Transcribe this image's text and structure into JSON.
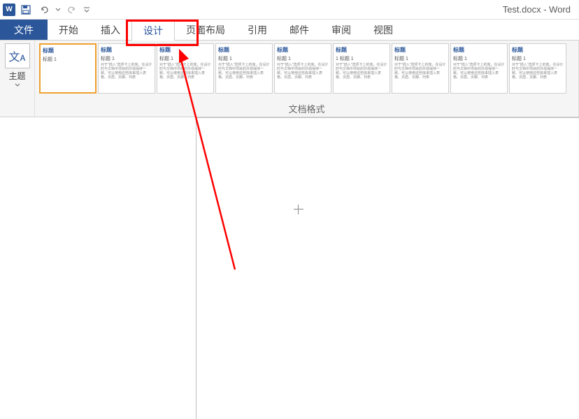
{
  "titlebar": {
    "app_icon": "W",
    "title": "Test.docx - Word"
  },
  "tabs": {
    "file": "文件",
    "home": "开始",
    "insert": "插入",
    "design": "设计",
    "layout": "页面布局",
    "references": "引用",
    "mailings": "邮件",
    "review": "审阅",
    "view": "视图"
  },
  "ribbon": {
    "themes_icon": "文ᴀ",
    "themes_label": "主题",
    "gallery_label": "文档格式",
    "gallery_items": [
      {
        "title": "标题",
        "sub": "标题 1",
        "body": ""
      },
      {
        "title": "标题",
        "sub": "标题 1",
        "body": "对于\"插入\"选项卡上的库，在设计时与文档中项目的外观保持一致。可以使用这些库来插入表格、页眉、页脚、列表"
      },
      {
        "title": "标题",
        "sub": "标题 1",
        "body": "对于\"插入\"选项卡上的库，在设计时与文档中项目的外观保持一致。可以使用这些库来插入表格、页眉、页脚、列表"
      },
      {
        "title": "标题",
        "sub": "标题 1",
        "body": "对于\"插入\"选项卡上的库，在设计时与文档中项目的外观保持一致。可以使用这些库来插入表格、页眉、页脚、列表"
      },
      {
        "title": "标题",
        "sub": "标题 1",
        "body": "对于\"插入\"选项卡上的库，在设计时与文档中项目的外观保持一致。可以使用这些库来插入表格、页眉、页脚、列表"
      },
      {
        "title": "标题",
        "sub": "1 标题 1",
        "body": "对于\"插入\"选项卡上的库，在设计时与文档中项目的外观保持一致。可以使用这些库来插入表格、页眉、页脚、列表"
      },
      {
        "title": "标题",
        "sub": "标题 1",
        "body": "对于\"插入\"选项卡上的库，在设计时与文档中项目的外观保持一致。可以使用这些库来插入表格、页眉、页脚、列表"
      },
      {
        "title": "标题",
        "sub": "标题 1",
        "body": "对于\"插入\"选项卡上的库，在设计时与文档中项目的外观保持一致。可以使用这些库来插入表格、页眉、页脚、列表"
      },
      {
        "title": "标题",
        "sub": "标题 1",
        "body": "对于\"插入\"选项卡上的库，在设计时与文档中项目的外观保持一致。可以使用这些库来插入表格、页眉、页脚、列表"
      }
    ]
  }
}
